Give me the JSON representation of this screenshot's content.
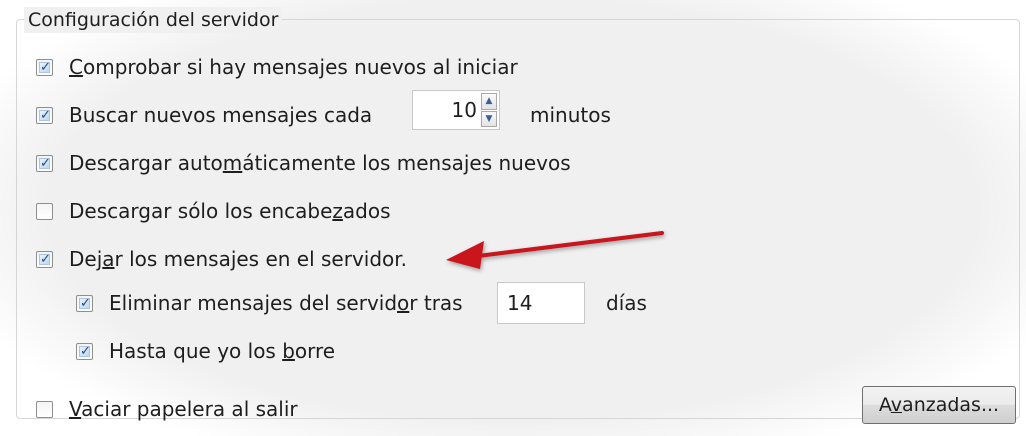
{
  "group": {
    "title": "Configuración del servidor"
  },
  "options": {
    "check_on_start": {
      "label_pre": "",
      "label_key": "C",
      "label_post": "omprobar si hay mensajes nuevos al iniciar",
      "checked": true
    },
    "check_every": {
      "label_pre": "Buscar nuevos mensa",
      "label_key": "j",
      "label_post": "es cada",
      "checked": true,
      "value": "10",
      "unit": "minutos"
    },
    "auto_download": {
      "label_pre": "Descargar auto",
      "label_key": "m",
      "label_post": "áticamente los mensajes nuevos",
      "checked": true
    },
    "headers_only": {
      "label_pre": "Descargar sólo los encabe",
      "label_key": "z",
      "label_post": "ados",
      "checked": false
    },
    "leave_on_server": {
      "label_pre": "Dej",
      "label_key": "a",
      "label_post": "r los mensajes en el servidor.",
      "checked": true
    },
    "delete_after": {
      "label_pre": "Eliminar mensajes del servid",
      "label_key": "o",
      "label_post": "r tras",
      "checked": true,
      "value": "14",
      "unit": "días"
    },
    "until_deleted": {
      "label_pre": "Hasta que yo los ",
      "label_key": "b",
      "label_post": "orre",
      "checked": true
    },
    "empty_trash": {
      "label_pre": "",
      "label_key": "V",
      "label_post": "aciar papelera al salir",
      "checked": false
    }
  },
  "buttons": {
    "advanced_pre": "A",
    "advanced_key": "v",
    "advanced_post": "anzadas..."
  },
  "icons": {
    "checkmark": "✓",
    "spin_up": "▲",
    "spin_down": "▼",
    "annotation": "red-arrow-icon"
  },
  "colors": {
    "annotation_arrow": "#c8161d",
    "panel_bg": "#f0f0f0"
  }
}
